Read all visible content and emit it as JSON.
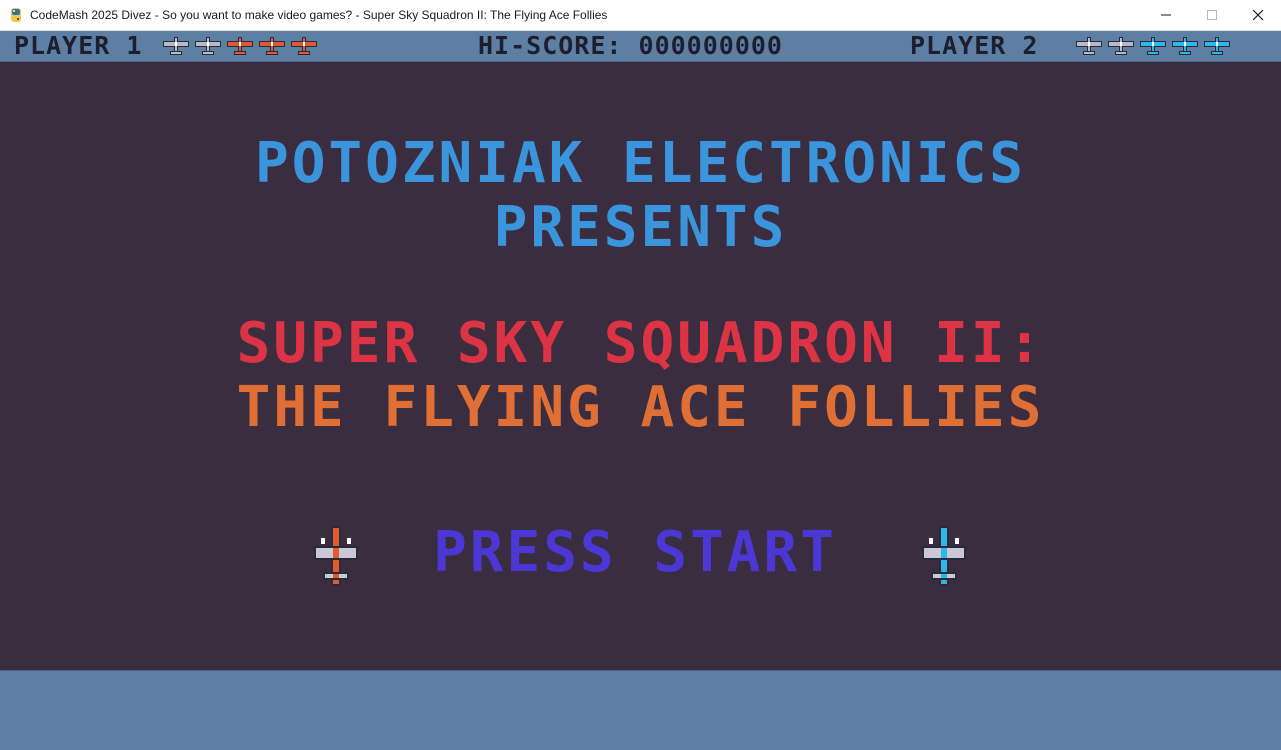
{
  "window": {
    "title": "CodeMash 2025 Divez - So you want to make video games? - Super Sky Squadron II: The Flying Ace Follies",
    "icon": "python-icon"
  },
  "hud": {
    "player1_label": "PLAYER 1",
    "hiscore_label": "HI-SCORE: 000000000",
    "player2_label": "PLAYER 2",
    "player1_lives": [
      "gray",
      "gray",
      "orange",
      "orange",
      "orange"
    ],
    "player2_lives": [
      "gray",
      "gray",
      "cyan",
      "cyan",
      "cyan"
    ]
  },
  "title_screen": {
    "presenter_line1": "POTOZNIAK ELECTRONICS",
    "presenter_line2": "PRESENTS",
    "game_title_line1": "SUPER SKY SQUADRON II:",
    "game_title_line2": "THE FLYING ACE FOLLIES",
    "press_start": "PRESS START"
  },
  "colors": {
    "background": "#3b2d40",
    "hud_bar": "#5d7fa3",
    "hud_text": "#1e1f2e",
    "presenter": "#3a95dc",
    "title_line1": "#dc3444",
    "title_line2": "#e06f36",
    "press_start": "#4a37d4",
    "player1_ship": "#e25a2c",
    "player2_ship": "#2cb7e6"
  }
}
